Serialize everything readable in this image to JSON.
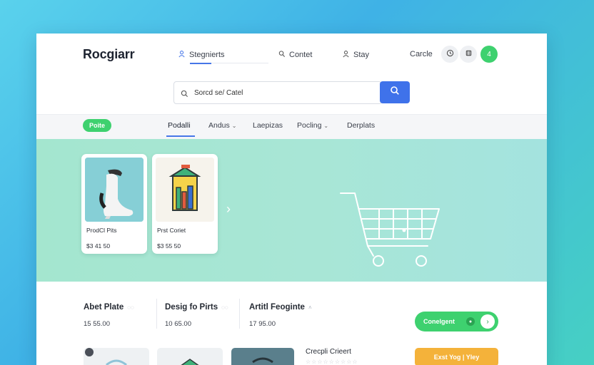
{
  "header": {
    "brand": "Rocgiarr",
    "nav": [
      "Stegnierts",
      "Contet",
      "Stay"
    ],
    "cart_label": "Carcle",
    "icon_buttons": [
      "clock-icon",
      "tag-icon",
      "plus-icon"
    ],
    "green_button_label": "4"
  },
  "search": {
    "value": "Sorcd se/ Catel"
  },
  "categories": {
    "badge": "Poite",
    "items": [
      "Podalli",
      "Andus",
      "Laepizas",
      "Pocling",
      "Derplats"
    ]
  },
  "hero": {
    "products": [
      {
        "name": "ProdCl Pits",
        "price": "$3 41 50"
      },
      {
        "name": "Prst Coriet",
        "price": "$3 55 50"
      }
    ],
    "next_arrow": "›"
  },
  "stats": [
    {
      "title": "Abet Plate",
      "value": "15 55.00"
    },
    {
      "title": "Desig fo Pirts",
      "value": "10 65.00"
    },
    {
      "title": "Artitl Feoginte",
      "value": "17 95.00"
    }
  ],
  "cta_green": {
    "label": "Conelgent",
    "arrow": "›"
  },
  "bottom": {
    "title": "Crecpli Crieert",
    "stars": "☆☆☆☆☆☆☆☆☆",
    "cta_orange": "Exst Yog | Yley"
  },
  "colors": {
    "accent_blue": "#3f72ea",
    "accent_green": "#3ed16f",
    "accent_orange": "#f4b23a",
    "hero_bg": "#a6e6d4"
  }
}
